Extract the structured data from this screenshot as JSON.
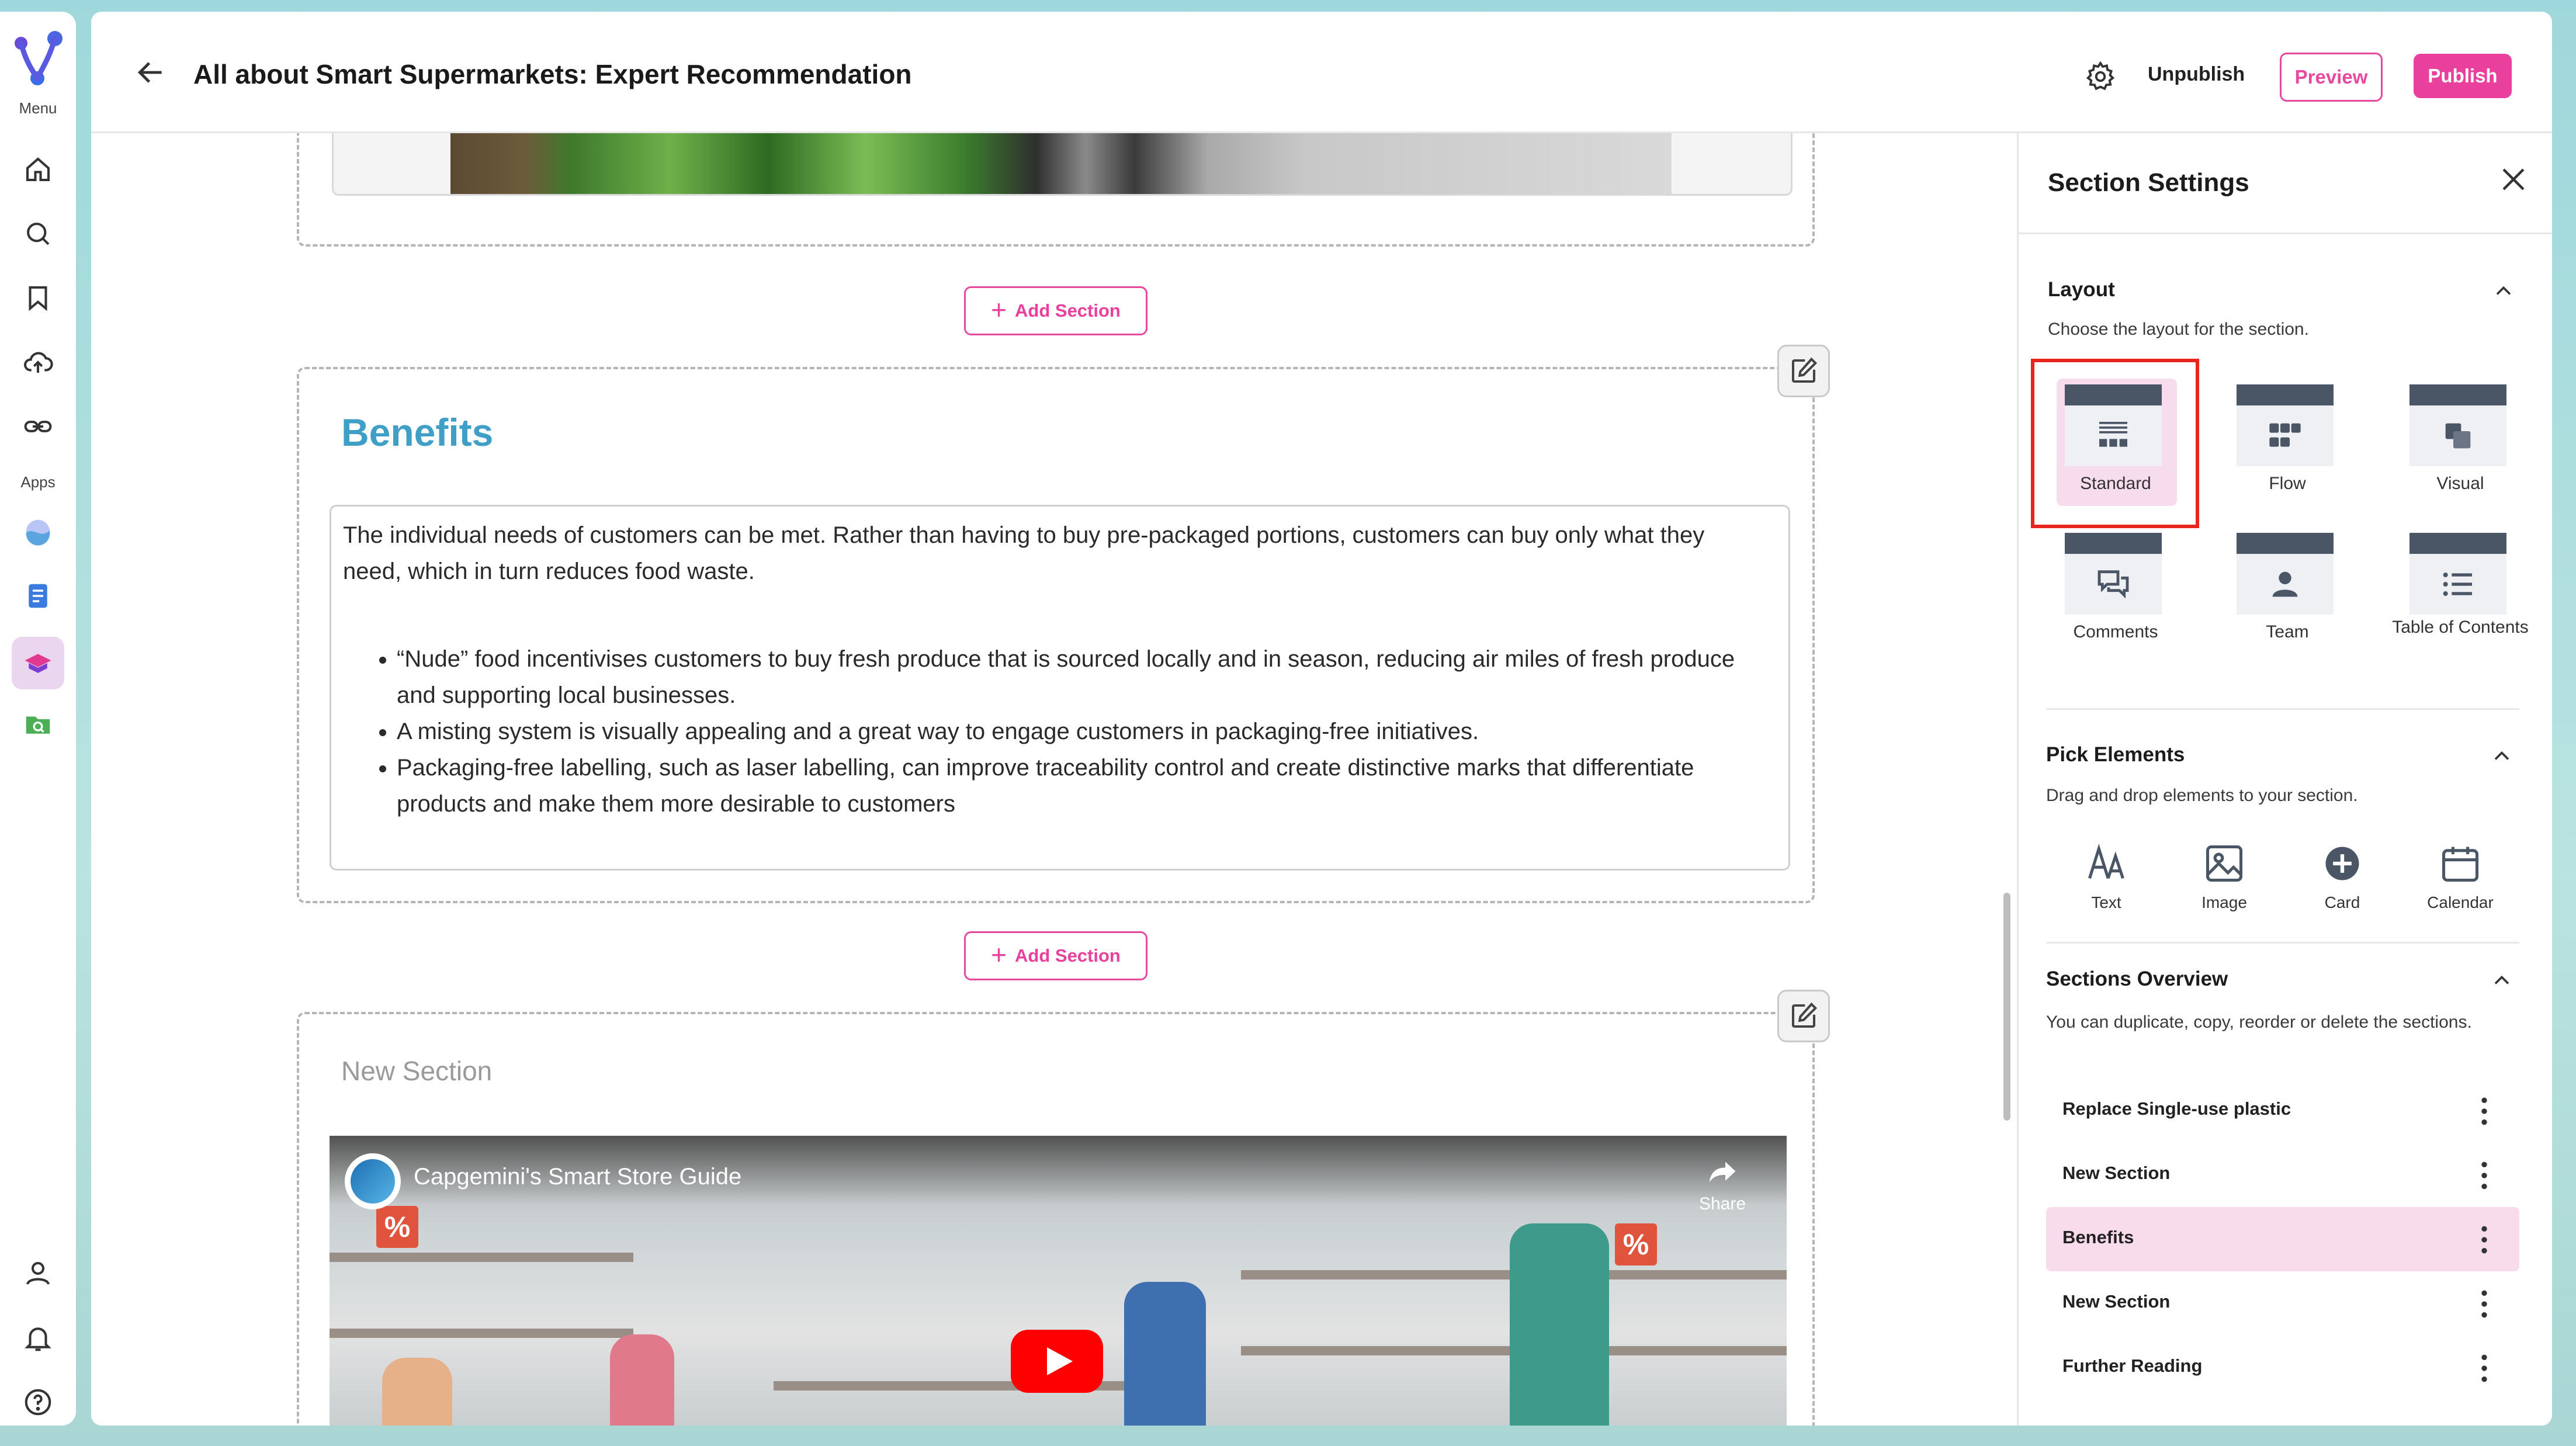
{
  "rail": {
    "menu_label": "Menu",
    "apps_label": "Apps"
  },
  "header": {
    "title": "All about Smart Supermarkets: Expert Recommendation",
    "unpublish_label": "Unpublish",
    "preview_label": "Preview",
    "publish_label": "Publish"
  },
  "editor": {
    "add_section_label": "Add Section",
    "benefits": {
      "title": "Benefits",
      "paragraph": "The individual needs of customers can be met. Rather than having to buy pre-packaged portions, customers can buy only what they need, which in turn reduces food waste.",
      "bullets": [
        "“Nude” food incentivises customers to buy fresh produce that is sourced locally and in season, reducing air miles of fresh produce and supporting local businesses.",
        "A misting system is visually appealing and a great way to engage customers in packaging-free initiatives.",
        "Packaging-free labelling, such as laser labelling, can improve traceability control and create distinctive marks that differentiate products and make them more desirable to customers"
      ]
    },
    "new_section": {
      "title": "New Section",
      "video_title": "Capgemini's Smart Store Guide",
      "share_label": "Share"
    }
  },
  "panel": {
    "title": "Section Settings",
    "layout": {
      "title": "Layout",
      "description": "Choose the layout for the section.",
      "options": [
        {
          "label": "Standard",
          "icon": "standard-layout-icon",
          "selected": true
        },
        {
          "label": "Flow",
          "icon": "flow-layout-icon"
        },
        {
          "label": "Visual",
          "icon": "visual-layout-icon"
        },
        {
          "label": "Comments",
          "icon": "comments-layout-icon"
        },
        {
          "label": "Team",
          "icon": "team-layout-icon"
        },
        {
          "label": "Table of Contents",
          "icon": "toc-layout-icon"
        }
      ]
    },
    "elements": {
      "title": "Pick Elements",
      "description": "Drag and drop elements to your section.",
      "items": [
        {
          "label": "Text",
          "icon": "text-icon"
        },
        {
          "label": "Image",
          "icon": "image-icon"
        },
        {
          "label": "Card",
          "icon": "card-icon"
        },
        {
          "label": "Calendar",
          "icon": "calendar-icon"
        }
      ]
    },
    "overview": {
      "title": "Sections Overview",
      "description": "You can duplicate, copy, reorder or delete the sections.",
      "rows": [
        {
          "label": "Replace Single-use plastic"
        },
        {
          "label": "New Section"
        },
        {
          "label": "Benefits",
          "active": true
        },
        {
          "label": "New Section"
        },
        {
          "label": "Further Reading"
        }
      ]
    }
  },
  "colors": {
    "accent": "#e8409c",
    "heading_blue": "#3f9fc6",
    "highlight_red": "#e8251f"
  }
}
